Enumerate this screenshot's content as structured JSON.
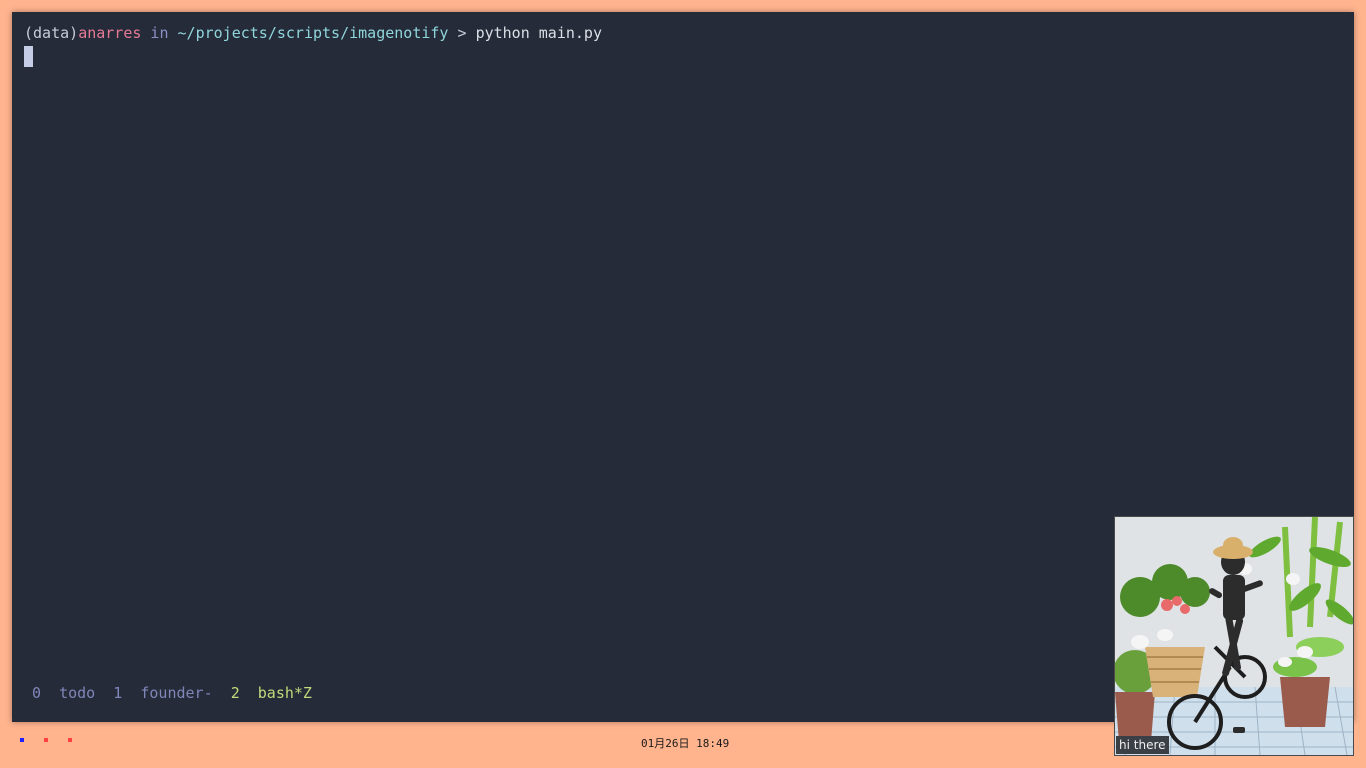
{
  "terminal": {
    "prompt": {
      "env": "(data)",
      "host": "anarres",
      "in_word": " in ",
      "path": "~/projects/scripts/imagenotify",
      "arrow": " > ",
      "command": "python main.py"
    },
    "colors": {
      "background": "#252b38",
      "host": "#e67a96",
      "path": "#8fd6dc",
      "in_word": "#8a8fc6",
      "active_window": "#c5d97a",
      "inactive_window": "#7f86b8"
    }
  },
  "tmux": {
    "windows": [
      {
        "index": "0",
        "name": "todo",
        "active": false
      },
      {
        "index": "1",
        "name": "founder-",
        "active": false
      },
      {
        "index": "2",
        "name": "bash*Z",
        "active": true
      }
    ]
  },
  "taskbar": {
    "tray_dots": [
      {
        "name": "tray-dot-blue",
        "color": "#2020ff"
      },
      {
        "name": "tray-dot-red-1",
        "color": "#ff4040"
      },
      {
        "name": "tray-dot-red-2",
        "color": "#ff4040"
      }
    ],
    "clock": "01月26日 18:49",
    "background": "#ffb48e"
  },
  "notification": {
    "caption": "hi there",
    "image_icon": "photo-thumbnail"
  }
}
